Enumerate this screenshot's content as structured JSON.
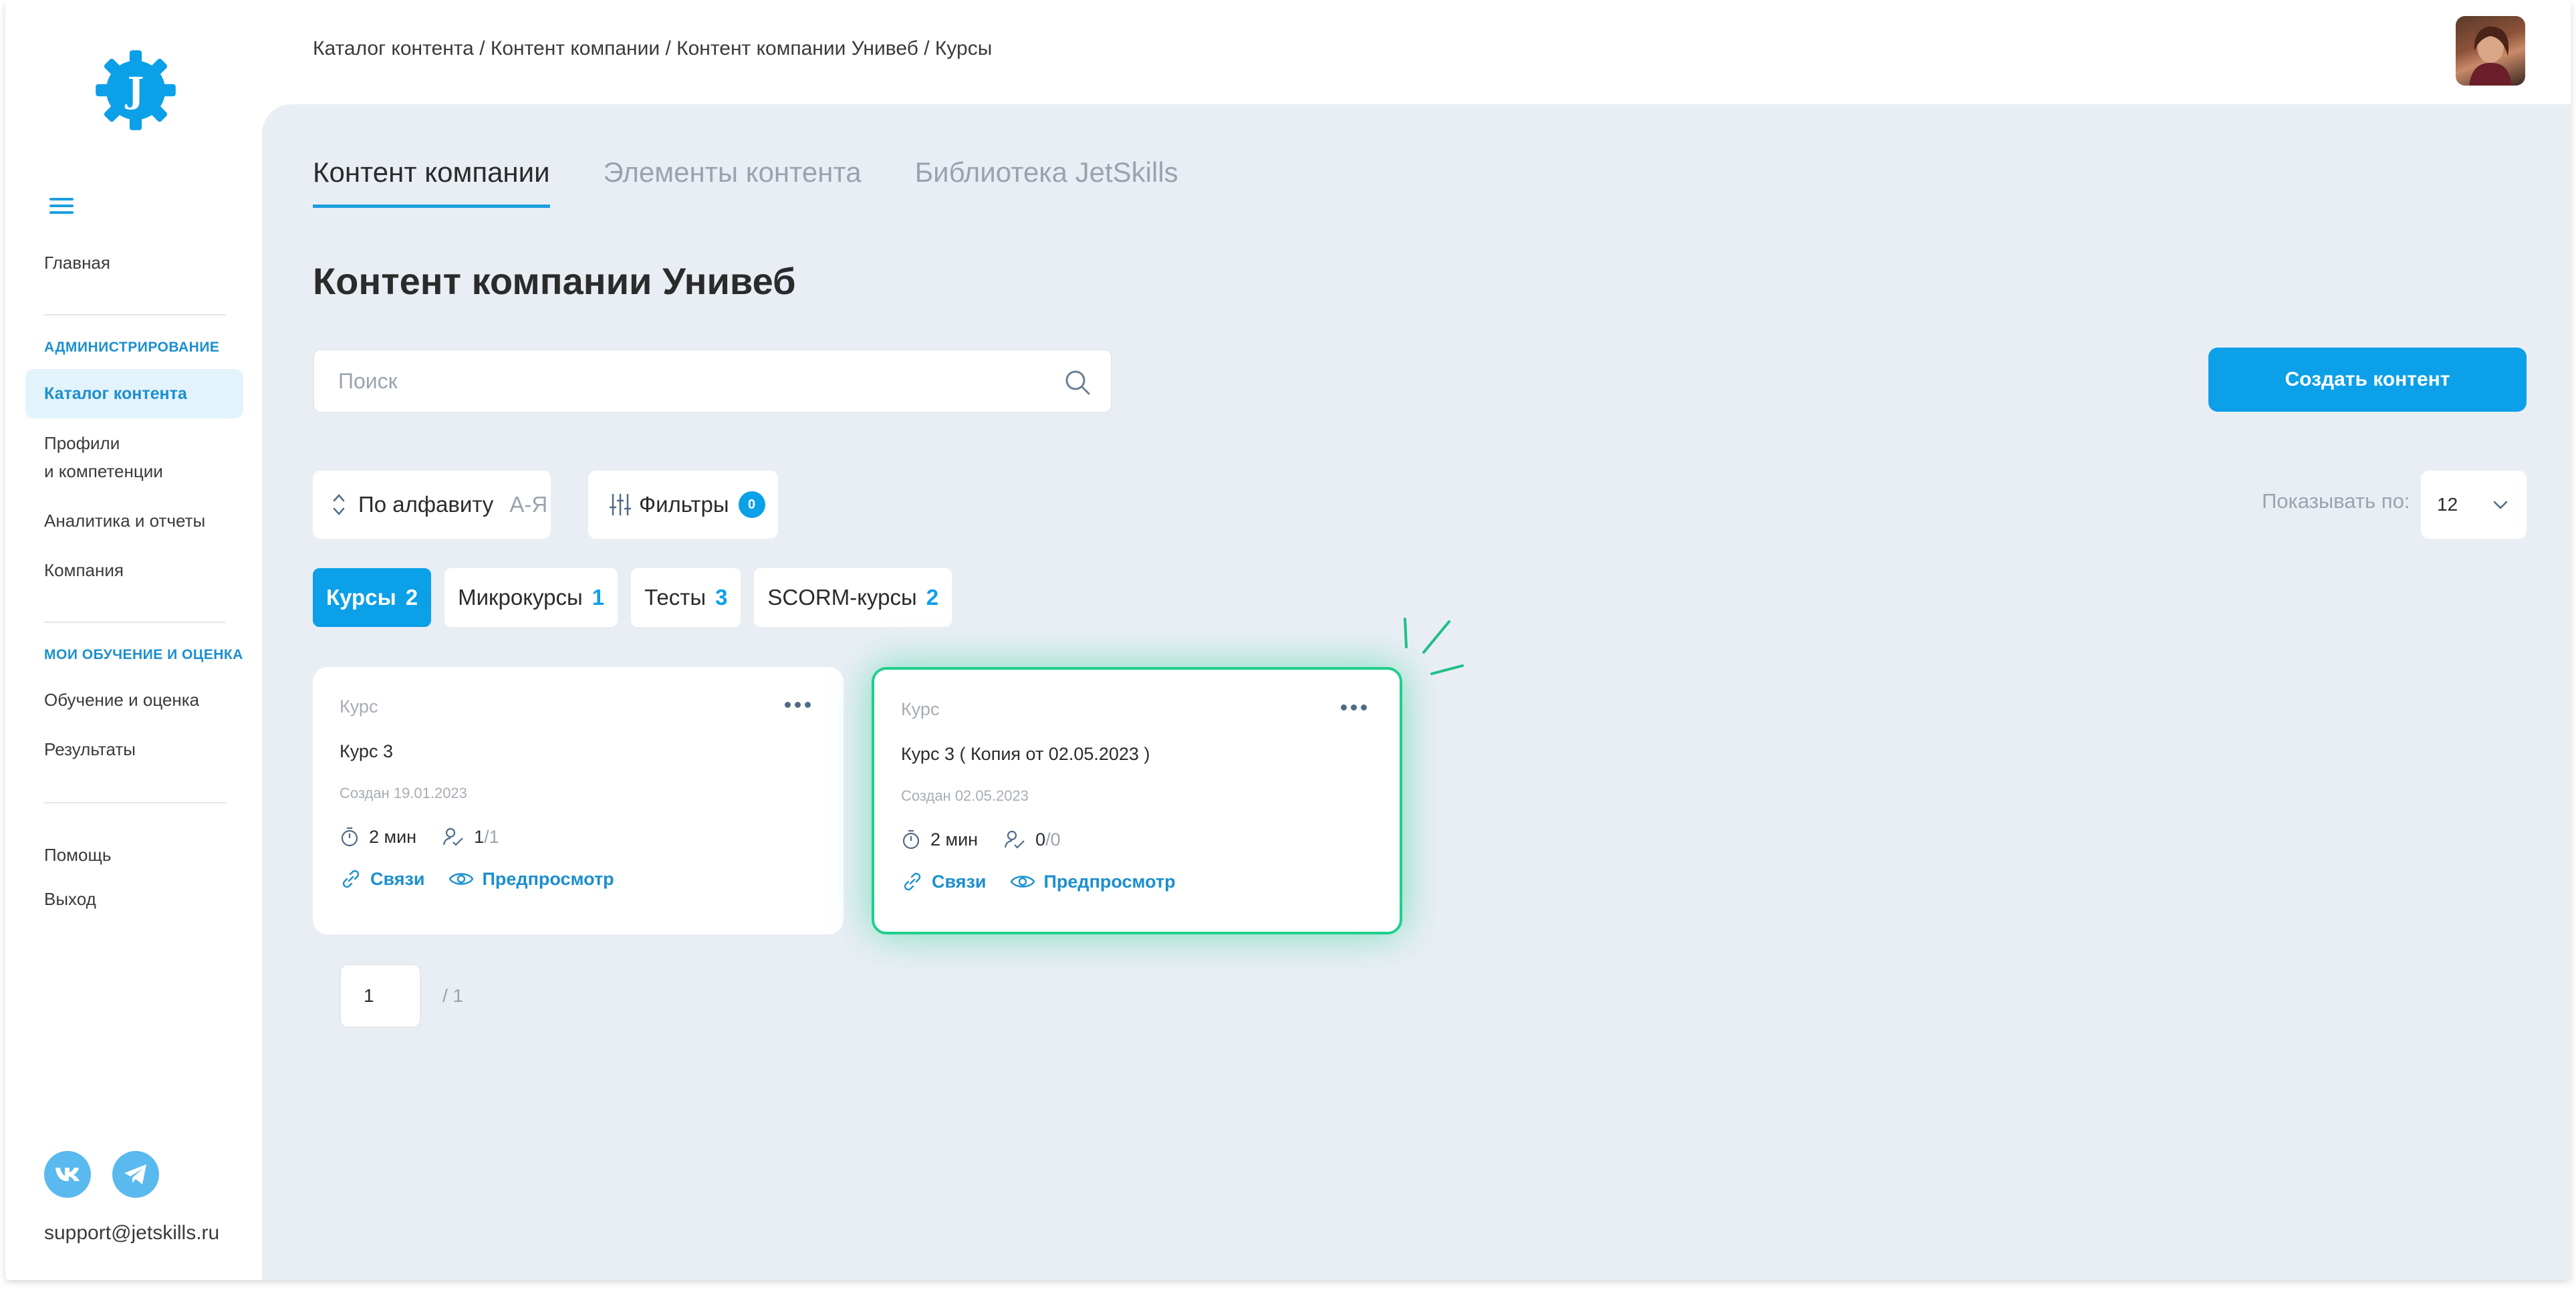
{
  "sidebar": {
    "nav_home": "Главная",
    "section_admin": "АДМИНИСТРИРОВАНИЕ",
    "nav_catalog": "Каталог контента",
    "nav_profiles_1": "Профили",
    "nav_profiles_2": "и компетенции",
    "nav_analytics": "Аналитика и отчеты",
    "nav_company": "Компания",
    "section_learning": "МОИ ОБУЧЕНИЕ И ОЦЕНКА",
    "nav_learning": "Обучение и оценка",
    "nav_results": "Результаты",
    "nav_help": "Помощь",
    "nav_logout": "Выход",
    "support_email": "support@jetskills.ru",
    "logo_letter": "J"
  },
  "breadcrumb": {
    "items": [
      "Каталог контента",
      "Контент компании",
      "Контент компании Унивеб",
      "Курсы"
    ],
    "separator": " / "
  },
  "tabs": [
    "Контент компании",
    "Элементы контента",
    "Библиотека JetSkills"
  ],
  "page_title": "Контент компании Унивеб",
  "search": {
    "placeholder": "Поиск"
  },
  "create_button": "Создать контент",
  "sort": {
    "label": "По алфавиту",
    "order": "А-Я"
  },
  "filters": {
    "label": "Фильтры",
    "count": "0"
  },
  "per_page": {
    "label": "Показывать по:",
    "value": "12"
  },
  "chips": [
    {
      "label": "Курсы",
      "count": "2"
    },
    {
      "label": "Микрокурсы",
      "count": "1"
    },
    {
      "label": "Тесты",
      "count": "3"
    },
    {
      "label": "SCORM-курсы",
      "count": "2"
    }
  ],
  "cards": [
    {
      "type": "Курс",
      "name": "Курс 3",
      "created": "Создан 19.01.2023",
      "duration": "2 мин",
      "assigned": "1",
      "assigned_total": "/1",
      "links_label": "Связи",
      "preview_label": "Предпросмотр"
    },
    {
      "type": "Курс",
      "name": "Курс 3 ( Копия от 02.05.2023 )",
      "created": "Создан 02.05.2023",
      "duration": "2 мин",
      "assigned": "0",
      "assigned_total": "/0",
      "links_label": "Связи",
      "preview_label": "Предпросмотр"
    }
  ],
  "pagination": {
    "current": "1",
    "total": "/ 1"
  },
  "colors": {
    "accent": "#0ba0e8",
    "highlight": "#1fcf8d",
    "background": "#e9eef5"
  }
}
